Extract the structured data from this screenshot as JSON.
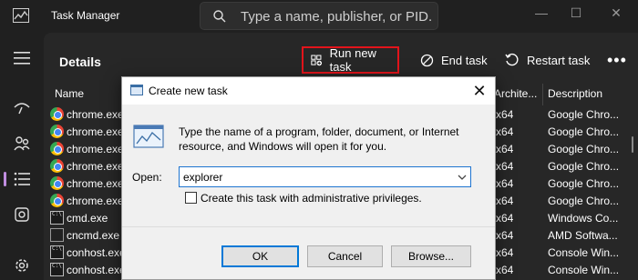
{
  "app": {
    "title": "Task Manager"
  },
  "search": {
    "placeholder": "Type a name, publisher, or PID..."
  },
  "window_controls": {
    "minimize": "—",
    "maximize": "☐",
    "close": "✕"
  },
  "page": {
    "title": "Details"
  },
  "toolbar": {
    "run_new_task": "Run new task",
    "end_task": "End task",
    "restart_task": "Restart task",
    "more": "•••"
  },
  "columns": {
    "name": "Name",
    "architecture": "Archite...",
    "description": "Description"
  },
  "processes": [
    {
      "name": "chrome.exe",
      "icon": "chrome-icon",
      "arch": "x64",
      "desc": "Google Chro..."
    },
    {
      "name": "chrome.exe",
      "icon": "chrome-icon",
      "arch": "x64",
      "desc": "Google Chro..."
    },
    {
      "name": "chrome.exe",
      "icon": "chrome-icon",
      "arch": "x64",
      "desc": "Google Chro..."
    },
    {
      "name": "chrome.exe",
      "icon": "chrome-icon",
      "arch": "x64",
      "desc": "Google Chro..."
    },
    {
      "name": "chrome.exe",
      "icon": "chrome-icon",
      "arch": "x64",
      "desc": "Google Chro..."
    },
    {
      "name": "chrome.exe",
      "icon": "chrome-icon",
      "arch": "x64",
      "desc": "Google Chro..."
    },
    {
      "name": "cmd.exe",
      "icon": "cmd-icon",
      "arch": "x64",
      "desc": "Windows Co..."
    },
    {
      "name": "cncmd.exe",
      "icon": "amd-icon",
      "arch": "x64",
      "desc": "AMD Softwa..."
    },
    {
      "name": "conhost.exe",
      "icon": "cmd-icon",
      "arch": "x64",
      "desc": "Console Win..."
    },
    {
      "name": "conhost.exe",
      "icon": "cmd-icon",
      "arch": "x64",
      "desc": "Console Win..."
    }
  ],
  "dialog": {
    "title": "Create new task",
    "description": "Type the name of a program, folder, document, or Internet resource, and Windows will open it for you.",
    "open_label": "Open:",
    "open_value": "explorer",
    "admin_checkbox_label": "Create this task with administrative privileges.",
    "admin_checked": false,
    "ok": "OK",
    "cancel": "Cancel",
    "browse": "Browse...",
    "close": "✕"
  },
  "colors": {
    "accent": "#c08ee0",
    "highlight": "#e3141b",
    "default_button": "#0078d7"
  }
}
